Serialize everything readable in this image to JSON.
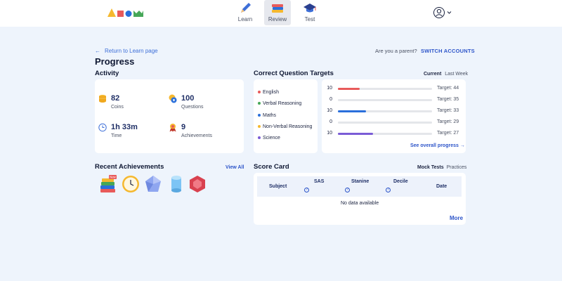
{
  "nav": {
    "items": [
      {
        "label": "Learn"
      },
      {
        "label": "Review"
      },
      {
        "label": "Test"
      }
    ]
  },
  "page": {
    "back_link": "Return to Learn page",
    "parent_question": "Are you a parent?",
    "switch_accounts": "SWITCH ACCOUNTS",
    "title": "Progress"
  },
  "activity": {
    "title": "Activity",
    "stats": [
      {
        "value": "82",
        "label": "Coins",
        "icon": "coins-icon"
      },
      {
        "value": "100",
        "label": "Questions",
        "icon": "questions-icon"
      },
      {
        "value": "1h 33m",
        "label": "Time",
        "icon": "clock-icon"
      },
      {
        "value": "9",
        "label": "Achievements",
        "icon": "medal-icon"
      }
    ]
  },
  "targets": {
    "title": "Correct Question Targets",
    "toggle_current": "Current",
    "toggle_last_week": "Last Week",
    "subjects": [
      {
        "name": "English",
        "color": "#e85a5a"
      },
      {
        "name": "Verbal Reasoning",
        "color": "#46a758"
      },
      {
        "name": "Maths",
        "color": "#2a6fdb"
      },
      {
        "name": "Non-Verbal Reasoning",
        "color": "#f5b82e"
      },
      {
        "name": "Science",
        "color": "#7a5cd6"
      }
    ],
    "rows": [
      {
        "count": "10",
        "target": "Target: 44",
        "progress": 0.23,
        "color": "#e85a5a"
      },
      {
        "count": "0",
        "target": "Target: 35",
        "progress": 0,
        "color": "#46a758"
      },
      {
        "count": "10",
        "target": "Target: 33",
        "progress": 0.3,
        "color": "#2a6fdb"
      },
      {
        "count": "0",
        "target": "Target: 29",
        "progress": 0,
        "color": "#f5b82e"
      },
      {
        "count": "10",
        "target": "Target: 27",
        "progress": 0.37,
        "color": "#7a5cd6"
      }
    ],
    "see_overall": "See overall progress →"
  },
  "achievements": {
    "title": "Recent Achievements",
    "view_all": "View All",
    "badges": [
      "books-badge-icon",
      "clock-badge-icon",
      "crystal-badge-icon",
      "cylinder-badge-icon",
      "ruby-badge-icon"
    ],
    "books_tag": "New"
  },
  "scorecard": {
    "title": "Score Card",
    "tab_mock": "Mock Tests",
    "tab_practices": "Practices",
    "columns": [
      "Subject",
      "SAS",
      "Stanine",
      "Decile",
      "Date"
    ],
    "help_mark": "?",
    "empty_text": "No data available",
    "more": "More"
  }
}
